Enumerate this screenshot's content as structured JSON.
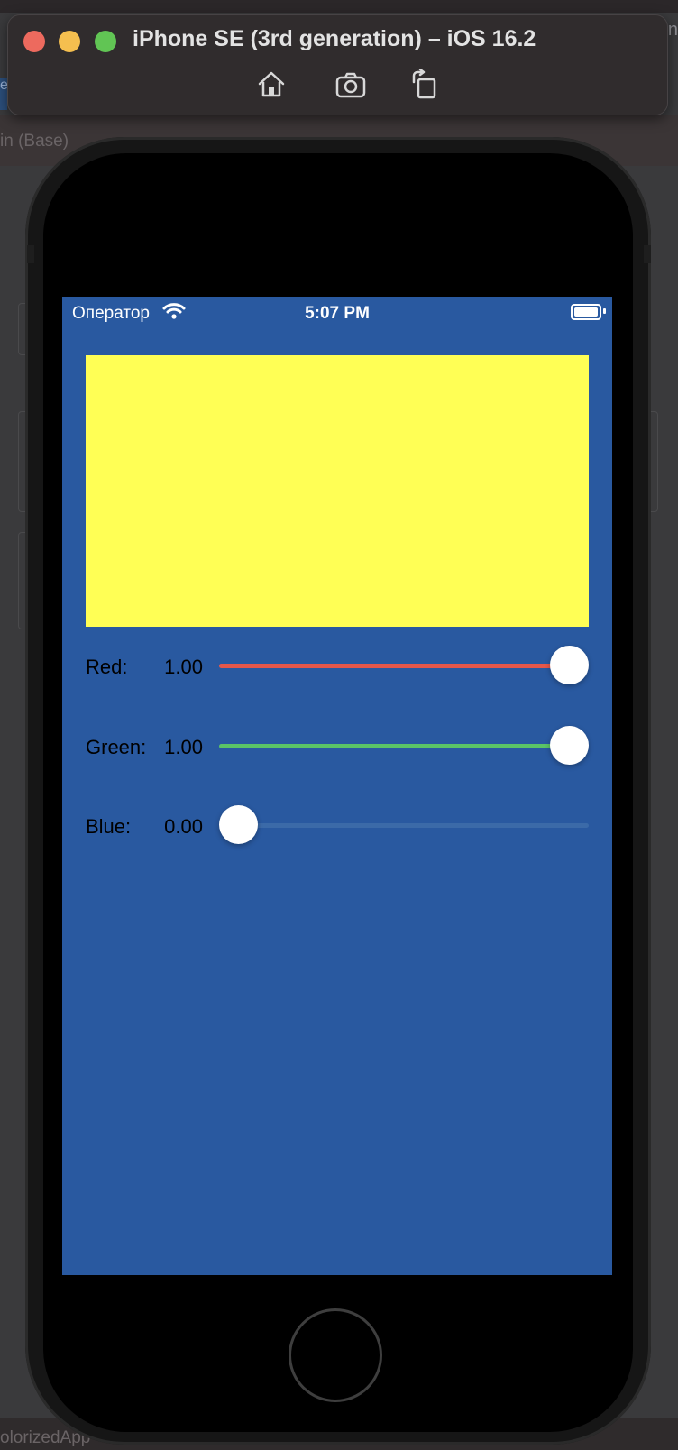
{
  "simulator": {
    "title": "iPhone SE (3rd generation) – iOS 16.2",
    "toolbar": {
      "home_icon": "home-icon",
      "screenshot_icon": "camera-icon",
      "rotate_icon": "rotate-icon"
    }
  },
  "xcode": {
    "breadcrumb": "in (Base)",
    "bottom_label": "olorizedApp",
    "right_cut": "n",
    "left_chip": "e"
  },
  "status_bar": {
    "carrier": "Оператор",
    "time": "5:07 PM"
  },
  "color_view": {
    "color": "#ffff55"
  },
  "sliders": [
    {
      "label": "Red:",
      "value_text": "1.00",
      "value": 1.0,
      "min_track_color": "#e5574a"
    },
    {
      "label": "Green:",
      "value_text": "1.00",
      "value": 1.0,
      "min_track_color": "#5ac466"
    },
    {
      "label": "Blue:",
      "value_text": "0.00",
      "value": 0.0,
      "min_track_color": "#3b6aa8"
    }
  ],
  "colors": {
    "screen_background": "#2959a0",
    "slider_max_track": "#3b6aa8"
  }
}
